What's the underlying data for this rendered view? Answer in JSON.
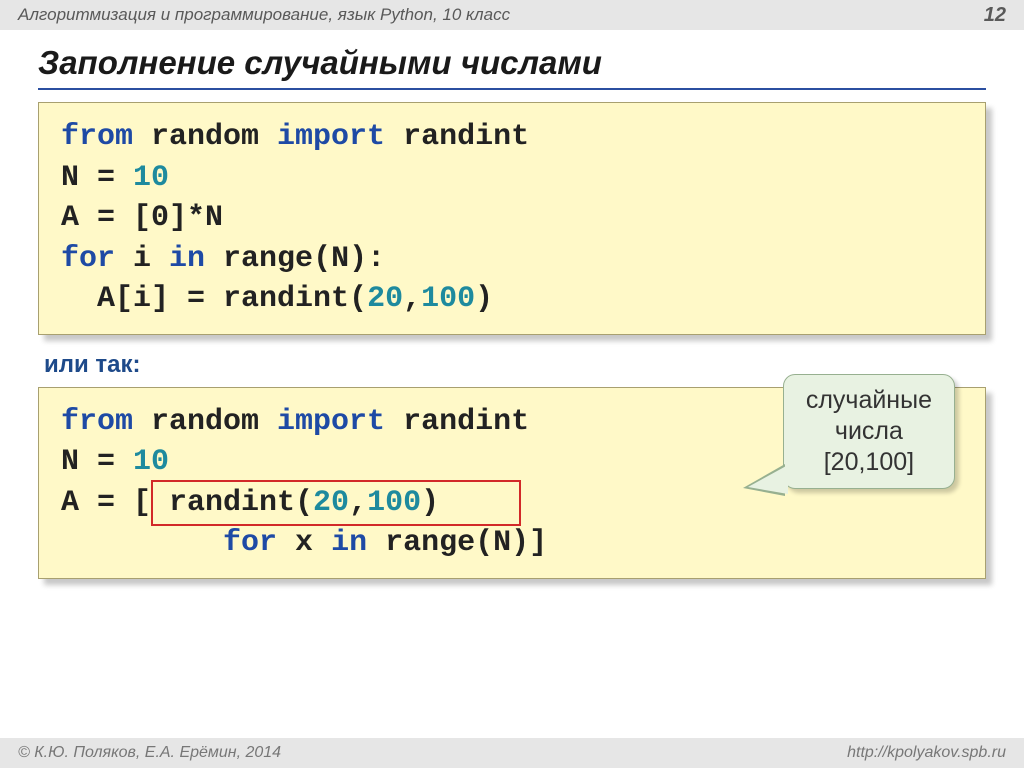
{
  "topbar": {
    "breadcrumb": "Алгоритмизация и программирование, язык Python, 10 класс",
    "page": "12"
  },
  "title": "Заполнение случайными числами",
  "code1": {
    "line1": {
      "kw_from": "from",
      "mod": " random ",
      "kw_import": "import",
      "func": " randint"
    },
    "line2": {
      "lhs": "N = ",
      "val": "10"
    },
    "line3": "A = [0]*N",
    "line4": {
      "kw_for": "for",
      "mid": " i ",
      "kw_in": "in",
      "rng": " range(N):"
    },
    "line5": {
      "pre": "  A[i] = randint(",
      "n1": "20",
      "comma": ",",
      "n2": "100",
      "post": ")"
    }
  },
  "or_label": "или так:",
  "code2": {
    "line1": {
      "kw_from": "from",
      "mod": " random ",
      "kw_import": "import",
      "func": " randint"
    },
    "line2": {
      "lhs": "N = ",
      "val": "10"
    },
    "line3": {
      "pre": "A = [ randint(",
      "n1": "20",
      "comma": ",",
      "n2": "100",
      "post": ")"
    },
    "line4": {
      "pad": "         ",
      "kw_for": "for",
      "mid": " x ",
      "kw_in": "in",
      "rng": " range(N)]"
    }
  },
  "callout": {
    "l1": "случайные",
    "l2": "числа",
    "l3": "[20,100]"
  },
  "footer": {
    "copyright": "© К.Ю. Поляков, Е.А. Ерёмин, 2014",
    "url": "http://kpolyakov.spb.ru"
  }
}
